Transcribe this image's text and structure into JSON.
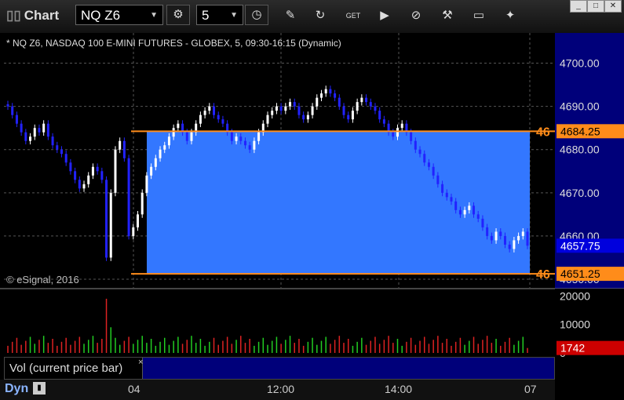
{
  "toolbar": {
    "app_title": "Chart",
    "symbol": "NQ Z6",
    "interval": "5",
    "icons": [
      "settings-icon",
      "clock-icon",
      "pencil-icon",
      "refresh-icon",
      "get-icon",
      "play-icon",
      "compass-icon",
      "tools-icon",
      "comment-icon",
      "twitter-icon"
    ]
  },
  "chart_header": "* NQ Z6, NASDAQ 100 E-MINI FUTURES - GLOBEX, 5, 09:30-16:15 (Dynamic)",
  "copyright": "© eSignal, 2016",
  "price_axis": [
    "4700.00",
    "4690.00",
    "4680.00",
    "4670.00",
    "4660.00",
    "4650.00"
  ],
  "volume_axis": [
    "20000",
    "10000",
    "0"
  ],
  "markers": {
    "upper_line_value": "4684.25",
    "upper_line_tag": "46",
    "lower_line_value": "4651.25",
    "lower_line_tag": "46",
    "last_price": "4657.75",
    "last_volume": "1742"
  },
  "legend": {
    "label": "Vol (current price bar)",
    "close": "×"
  },
  "bottom": {
    "dyn": "Dyn",
    "time_labels": [
      "04",
      "12:00",
      "14:00",
      "07"
    ]
  },
  "colors": {
    "up": "#ffffff",
    "down": "#2222ff",
    "rect_fill": "#3377ff",
    "line": "#ff8c1a",
    "vol_up": "#22cc22",
    "vol_down": "#dd2222"
  },
  "chart_data": {
    "type": "candlestick",
    "title": "* NQ Z6, NASDAQ 100 E-MINI FUTURES - GLOBEX, 5, 09:30-16:15 (Dynamic)",
    "ylim": [
      4648,
      4707
    ],
    "grid": true,
    "horizontal_lines": [
      4684.25,
      4651.25
    ],
    "highlight_range": [
      4651.25,
      4684.25
    ],
    "closes": [
      4690,
      4688,
      4686,
      4684,
      4682,
      4683,
      4685,
      4684,
      4686,
      4683,
      4681,
      4680,
      4679,
      4677,
      4675,
      4673,
      4671,
      4672,
      4674,
      4676,
      4675,
      4673,
      4655,
      4670,
      4680,
      4682,
      4678,
      4660,
      4662,
      4665,
      4670,
      4674,
      4676,
      4678,
      4680,
      4681,
      4683,
      4685,
      4686,
      4684,
      4682,
      4684,
      4686,
      4688,
      4689,
      4690,
      4688,
      4687,
      4686,
      4684,
      4682,
      4683,
      4682,
      4681,
      4680,
      4682,
      4684,
      4686,
      4688,
      4689,
      4690,
      4689,
      4690,
      4691,
      4690,
      4688,
      4687,
      4688,
      4690,
      4692,
      4693,
      4694,
      4693,
      4692,
      4690,
      4688,
      4687,
      4689,
      4691,
      4692,
      4691,
      4690,
      4689,
      4687,
      4686,
      4684,
      4683,
      4685,
      4686,
      4684,
      4682,
      4680,
      4679,
      4677,
      4676,
      4674,
      4672,
      4670,
      4669,
      4668,
      4666,
      4665,
      4666,
      4667,
      4665,
      4664,
      4662,
      4660,
      4659,
      4661,
      4660,
      4658,
      4657,
      4659,
      4660,
      4661,
      4657.75
    ],
    "last_price": 4657.75,
    "volume_ylim": [
      0,
      22000
    ],
    "volume_last": 1742
  }
}
